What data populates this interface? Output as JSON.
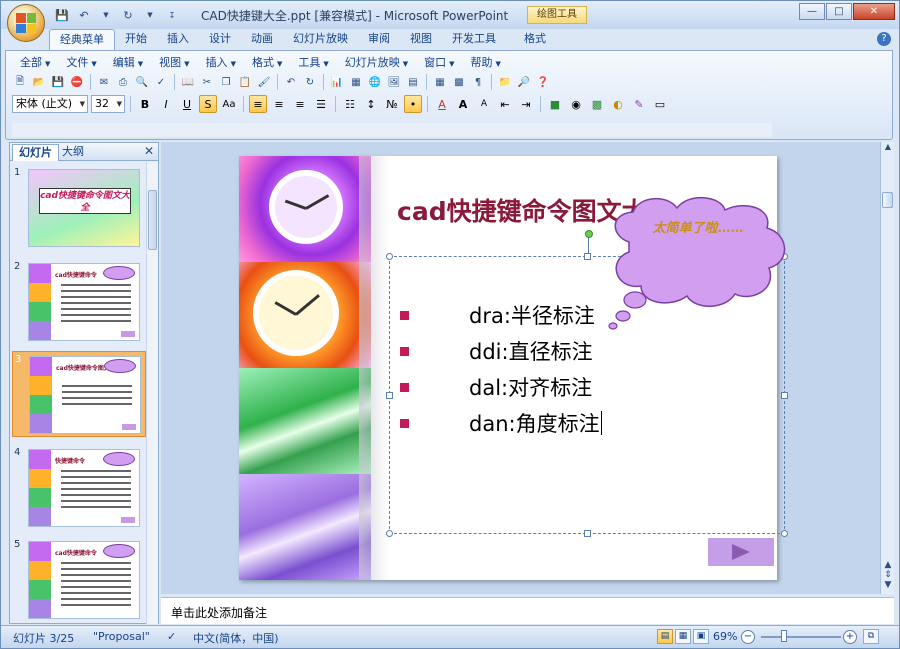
{
  "window": {
    "title": "CAD快捷键大全.ppt [兼容模式] - Microsoft PowerPoint",
    "context_tab_label": "绘图工具"
  },
  "ribbon": {
    "tabs": [
      "经典菜单",
      "开始",
      "插入",
      "设计",
      "动画",
      "幻灯片放映",
      "审阅",
      "视图",
      "开发工具",
      "格式"
    ],
    "active_tab": "经典菜单",
    "menus": [
      "全部",
      "文件",
      "编辑",
      "视图",
      "插入",
      "格式",
      "工具",
      "幻灯片放映",
      "窗口",
      "帮助"
    ],
    "font_name": "宋体 (止文)",
    "font_size": "32"
  },
  "left_pane": {
    "tabs": [
      "幻灯片",
      "大纲"
    ],
    "active_tab": "幻灯片",
    "thumbnails": [
      {
        "num": "1",
        "title": "cad快捷键命令图文大全"
      },
      {
        "num": "2",
        "title": "cad快捷键命令"
      },
      {
        "num": "3",
        "title": "cad快捷键命令图文"
      },
      {
        "num": "4",
        "title": "快捷键命令"
      },
      {
        "num": "5",
        "title": "cad快捷键命令"
      }
    ],
    "selected_slide": "3"
  },
  "slide": {
    "title": "cad快捷键命令图文大全",
    "bullets": [
      "dra:半径标注",
      "ddi:直径标注",
      "dal:对齐标注",
      "dan:角度标注"
    ],
    "callout_text": "太简单了啦……"
  },
  "notes": {
    "placeholder": "单击此处添加备注"
  },
  "status": {
    "slide_info": "幻灯片 3/25",
    "theme": "\"Proposal\"",
    "language": "中文(简体，中国)",
    "zoom": "69%"
  },
  "colors": {
    "title": "#8b1a3a",
    "bullet": "#c51a5a",
    "cloud_fill": "#d29ef0",
    "selection_orange": "#f6b96a"
  }
}
